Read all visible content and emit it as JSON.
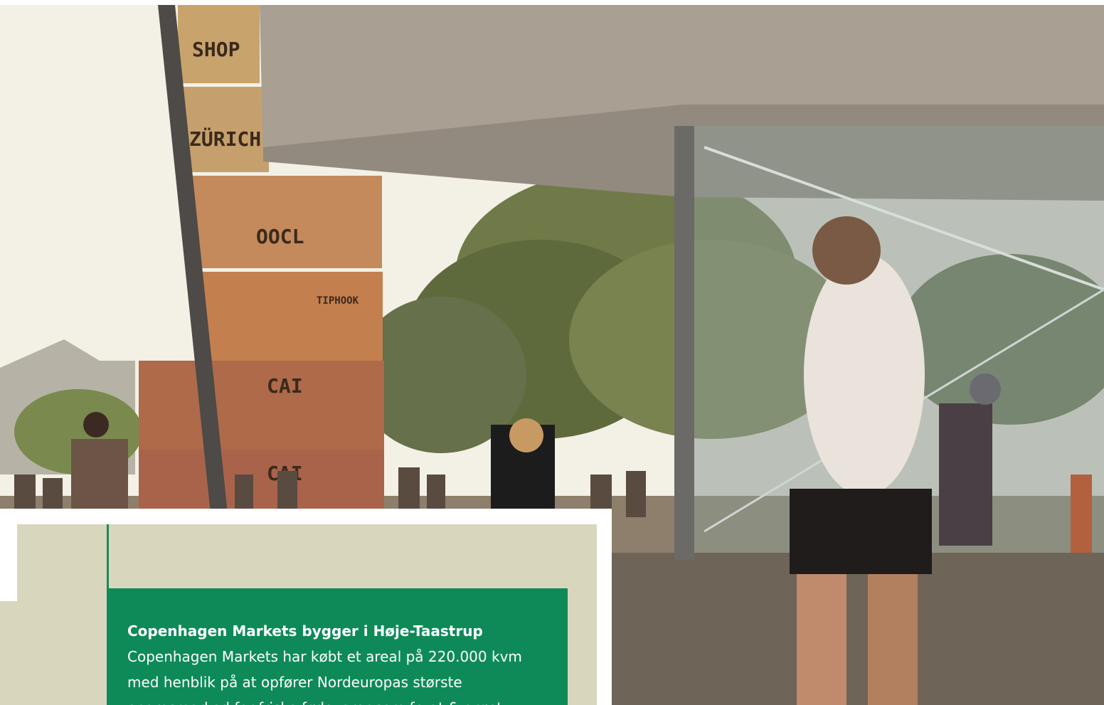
{
  "hero": {
    "container_labels": [
      "SHOP",
      "ZÜRICH",
      "OOCL",
      "TIPHOOK",
      "CAI",
      "CAI"
    ]
  },
  "news": {
    "title": "Copenhagen Markets bygger i Høje-Taastrup",
    "body": "Copenhagen Markets har købt et areal på 220.000 kvm med henblik på at opfører Nordeuropas største engrosmarked for friske fødevarer som frugt & grønt."
  },
  "colors": {
    "accent_green": "#0e8a58",
    "beige": "#d9d6be"
  }
}
